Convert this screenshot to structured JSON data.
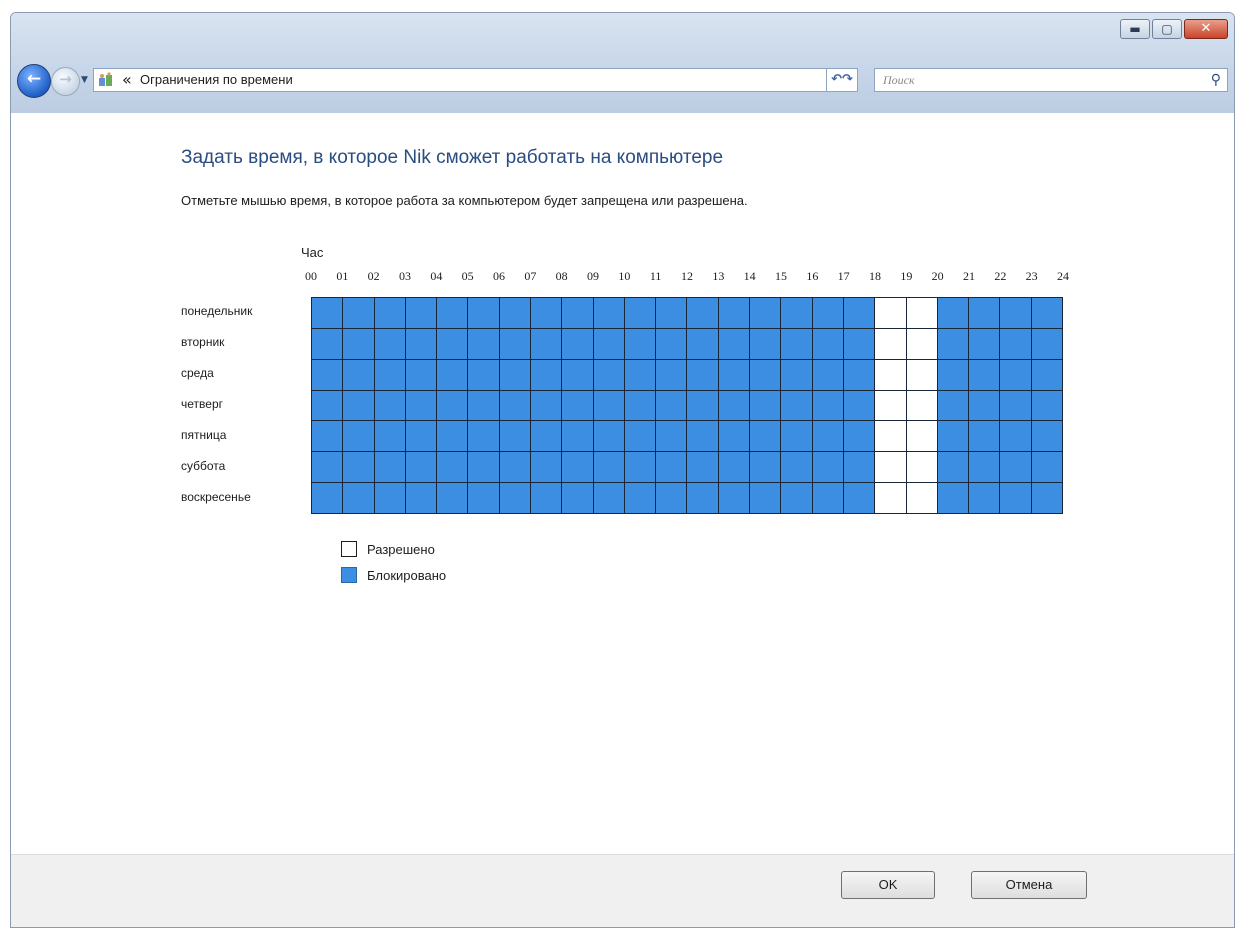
{
  "window": {
    "caption_buttons": [
      "minimize-icon",
      "maximize-icon",
      "close-icon"
    ]
  },
  "nav": {
    "back_icon": "back-arrow-icon",
    "forward_icon": "forward-arrow-icon",
    "history_icon": "history-dropdown-icon"
  },
  "address": {
    "breadcrumb_chevron": "«",
    "path": "Ограничения по времени",
    "icon": "parental-controls-icon"
  },
  "search": {
    "placeholder": "Поиск",
    "icon": "search-icon"
  },
  "main": {
    "title": "Задать время, в которое Nik сможет работать на компьютере",
    "subtitle": "Отметьте мышью время, в которое работа за компьютером будет запрещена или разрешена."
  },
  "schedule": {
    "hour_caption": "Час",
    "hours": [
      "00",
      "01",
      "02",
      "03",
      "04",
      "05",
      "06",
      "07",
      "08",
      "09",
      "10",
      "11",
      "12",
      "13",
      "14",
      "15",
      "16",
      "17",
      "18",
      "19",
      "20",
      "21",
      "22",
      "23",
      "24"
    ],
    "days": [
      "понедельник",
      "вторник",
      "среда",
      "четверг",
      "пятница",
      "суббота",
      "воскресенье"
    ],
    "allowed_hour_indices": [
      18,
      19
    ],
    "colors": {
      "blocked": "#3b8ee2",
      "allowed": "#ffffff",
      "grid_line": "#1b2538"
    }
  },
  "legend": {
    "allowed": "Разрешено",
    "blocked": "Блокировано"
  },
  "footer": {
    "ok_label": "OK",
    "cancel_label": "Отмена"
  }
}
